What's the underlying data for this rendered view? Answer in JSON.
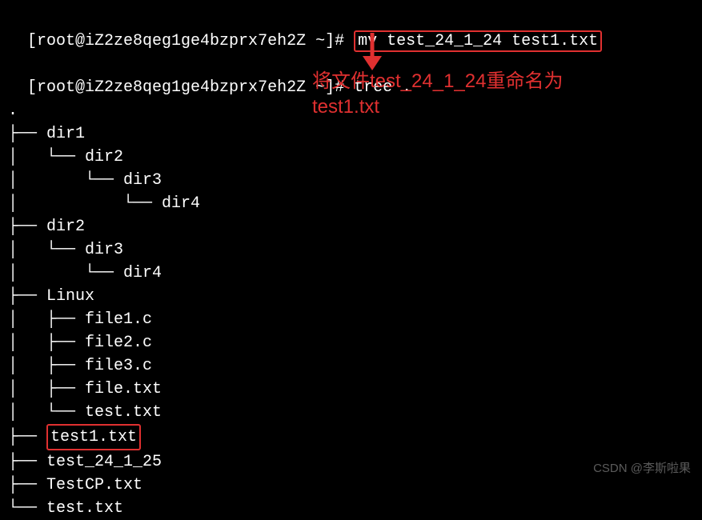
{
  "prompt1": {
    "host": "[root@iZ2ze8qeg1ge4bzprx7eh2Z ~]# ",
    "cmd": "mv test_24_1_24 test1.txt"
  },
  "prompt2": {
    "host": "[root@iZ2ze8qeg1ge4bzprx7eh2Z ~]# ",
    "cmd": "tree ."
  },
  "tree_root": ".",
  "tree_lines": [
    "├── dir1",
    "│   └── dir2",
    "│       └── dir3",
    "│           └── dir4",
    "├── dir2",
    "│   └── dir3",
    "│       └── dir4",
    "├── Linux",
    "│   ├── file1.c",
    "│   ├── file2.c",
    "│   ├── file3.c",
    "│   ├── file.txt",
    "│   └── test.txt"
  ],
  "highlight_line_prefix": "├── ",
  "highlight_file": "test1.txt",
  "tree_lines_after": [
    "├── test_24_1_25",
    "├── TestCP.txt",
    "└── test.txt"
  ],
  "annotation": {
    "line1": "将文件test_24_1_24重命名为",
    "line2": "test1.txt"
  },
  "watermark": "CSDN @李斯啦果"
}
